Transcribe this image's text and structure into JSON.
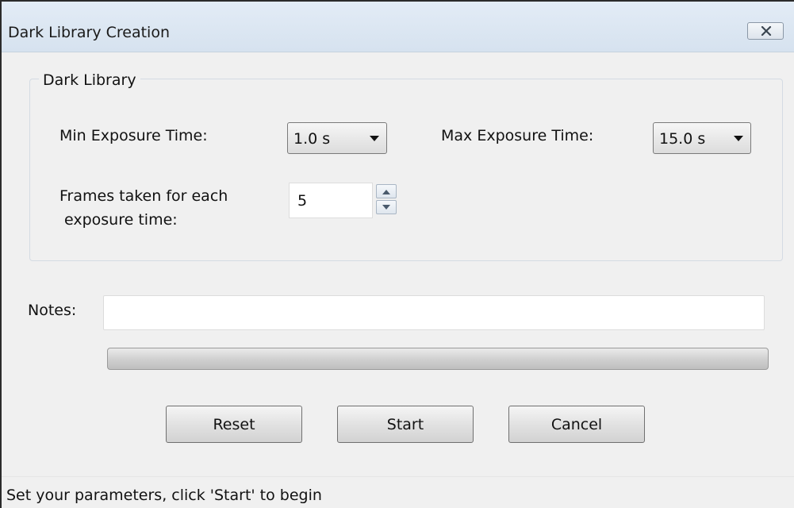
{
  "window": {
    "title": "Dark Library Creation",
    "close_icon": "close-icon"
  },
  "group": {
    "title": "Dark Library"
  },
  "min_exposure": {
    "label": "Min Exposure Time:",
    "value": "1.0 s"
  },
  "max_exposure": {
    "label": "Max Exposure Time:",
    "value": "15.0 s"
  },
  "frames": {
    "label_line1": "Frames taken for each",
    "label_line2": "exposure time:",
    "value": "5"
  },
  "notes": {
    "label": "Notes:",
    "value": ""
  },
  "progress": {
    "percent": 0,
    "fill_color": "#36b24a"
  },
  "buttons": {
    "reset": "Reset",
    "start": "Start",
    "cancel": "Cancel"
  },
  "status": {
    "text": "Set your parameters, click 'Start' to begin"
  }
}
